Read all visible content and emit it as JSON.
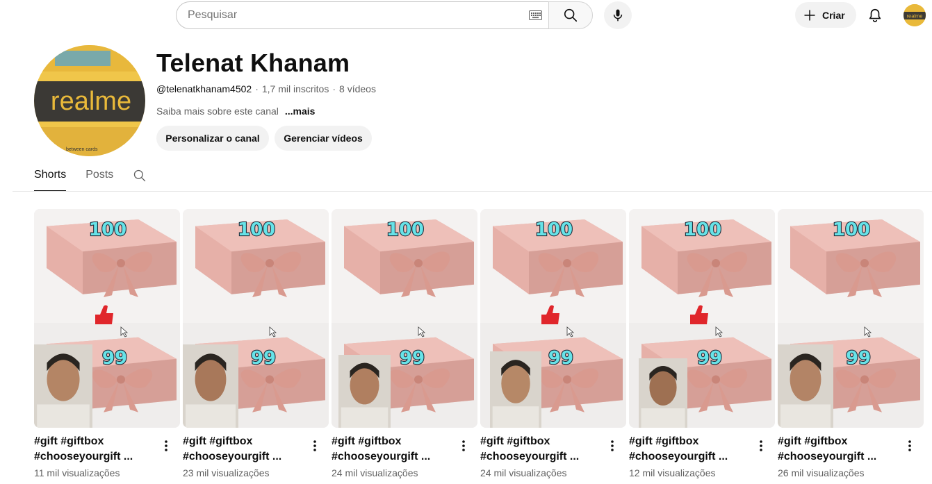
{
  "search": {
    "placeholder": "Pesquisar"
  },
  "header": {
    "create_label": "Criar"
  },
  "channel": {
    "name": "Telenat Khanam",
    "handle": "@telenatkhanam4502",
    "separator": "·",
    "subscribers": "1,7 mil inscritos",
    "videos": "8 vídeos",
    "about": "Saiba mais sobre este canal",
    "more": "...mais",
    "customize_label": "Personalizar o canal",
    "manage_label": "Gerenciar vídeos",
    "avatar_brand": "realme",
    "avatar_small_text": "between cards"
  },
  "tabs": [
    {
      "label": "Shorts",
      "active": true
    },
    {
      "label": "Posts",
      "active": false
    }
  ],
  "shorts": [
    {
      "title_line1": "#gift #giftbox",
      "title_line2": "#chooseyourgift ...",
      "views": "11 mil visualizações",
      "top_number": "100",
      "bottom_number": "99"
    },
    {
      "title_line1": "#gift #giftbox",
      "title_line2": "#chooseyourgift ...",
      "views": "23 mil visualizações",
      "top_number": "100",
      "bottom_number": "99"
    },
    {
      "title_line1": "#gift #giftbox",
      "title_line2": "#chooseyourgift ...",
      "views": "24 mil visualizações",
      "top_number": "100",
      "bottom_number": "99"
    },
    {
      "title_line1": "#gift #giftbox",
      "title_line2": "#chooseyourgift ...",
      "views": "24 mil visualizações",
      "top_number": "100",
      "bottom_number": "99"
    },
    {
      "title_line1": "#gift #giftbox",
      "title_line2": "#chooseyourgift ...",
      "views": "12 mil visualizações",
      "top_number": "100",
      "bottom_number": "99"
    },
    {
      "title_line1": "#gift #giftbox",
      "title_line2": "#chooseyourgift ...",
      "views": "26 mil visualizações",
      "top_number": "100",
      "bottom_number": "99"
    }
  ],
  "colors": {
    "gift_box": "#e6b0a8",
    "gift_box_dark": "#c99189",
    "ribbon": "#d99a8f",
    "number_fill": "#67e3e8",
    "number_stroke": "#1c2a38",
    "thumbs_up": "#e0262b",
    "avatar_bg": "#e9b93a"
  },
  "icons": [
    "keyboard-icon",
    "search-icon",
    "mic-icon",
    "plus-icon",
    "bell-icon",
    "more-vert-icon",
    "thumbs-up-icon",
    "cursor-icon"
  ]
}
